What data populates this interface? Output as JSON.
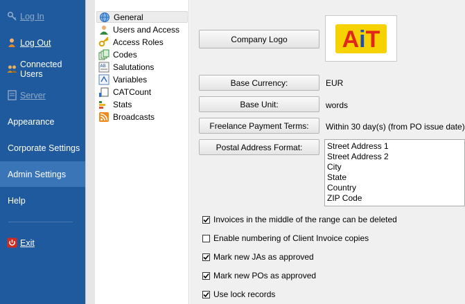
{
  "sidebar": {
    "items": [
      {
        "label": "Log In",
        "icon": "key-icon",
        "disabled": true
      },
      {
        "label": "Log Out",
        "icon": "user-logout-icon",
        "disabled": false
      },
      {
        "label": "Connected Users",
        "icon": "users-icon",
        "disabled": false
      },
      {
        "label": "Server",
        "icon": "server-icon",
        "disabled": true
      },
      {
        "label": "Appearance"
      },
      {
        "label": "Corporate Settings"
      },
      {
        "label": "Admin Settings",
        "selected": true
      },
      {
        "label": "Help"
      },
      {
        "label": "Exit",
        "icon": "power-icon"
      }
    ]
  },
  "tree": {
    "items": [
      {
        "label": "General",
        "icon": "globe-icon",
        "selected": true
      },
      {
        "label": "Users and Access",
        "icon": "users-access-icon"
      },
      {
        "label": "Access Roles",
        "icon": "key-icon"
      },
      {
        "label": "Codes",
        "icon": "codes-icon"
      },
      {
        "label": "Salutations",
        "icon": "salutations-icon"
      },
      {
        "label": "Variables",
        "icon": "variables-icon"
      },
      {
        "label": "CATCount",
        "icon": "catcount-icon"
      },
      {
        "label": "Stats",
        "icon": "stats-icon"
      },
      {
        "label": "Broadcasts",
        "icon": "rss-icon"
      }
    ]
  },
  "general": {
    "company_logo_button": "Company Logo",
    "logo_text": "AiT",
    "base_currency_button": "Base Currency:",
    "base_currency_value": "EUR",
    "base_unit_button": "Base Unit:",
    "base_unit_value": "words",
    "payment_terms_button": "Freelance Payment Terms:",
    "payment_terms_value": "Within 30 day(s) (from PO issue date)",
    "postal_format_button": "Postal Address Format:",
    "postal_format_lines": [
      "Street Address 1",
      "Street Address 2",
      "City",
      "State",
      "Country",
      "ZIP Code"
    ],
    "checkboxes": [
      {
        "label": "Invoices in the middle of the range can be deleted",
        "checked": true
      },
      {
        "label": "Enable numbering of Client Invoice copies",
        "checked": false
      },
      {
        "label": "Mark new JAs as approved",
        "checked": true
      },
      {
        "label": "Mark new POs as approved",
        "checked": true
      },
      {
        "label": "Use lock records",
        "checked": true
      }
    ]
  },
  "colors": {
    "sidebar_bg": "#1f5a9e",
    "sidebar_selected": "#3a75b8",
    "logo_yellow": "#f5d200",
    "logo_red": "#e0261b",
    "logo_blue": "#1b4fb5"
  }
}
